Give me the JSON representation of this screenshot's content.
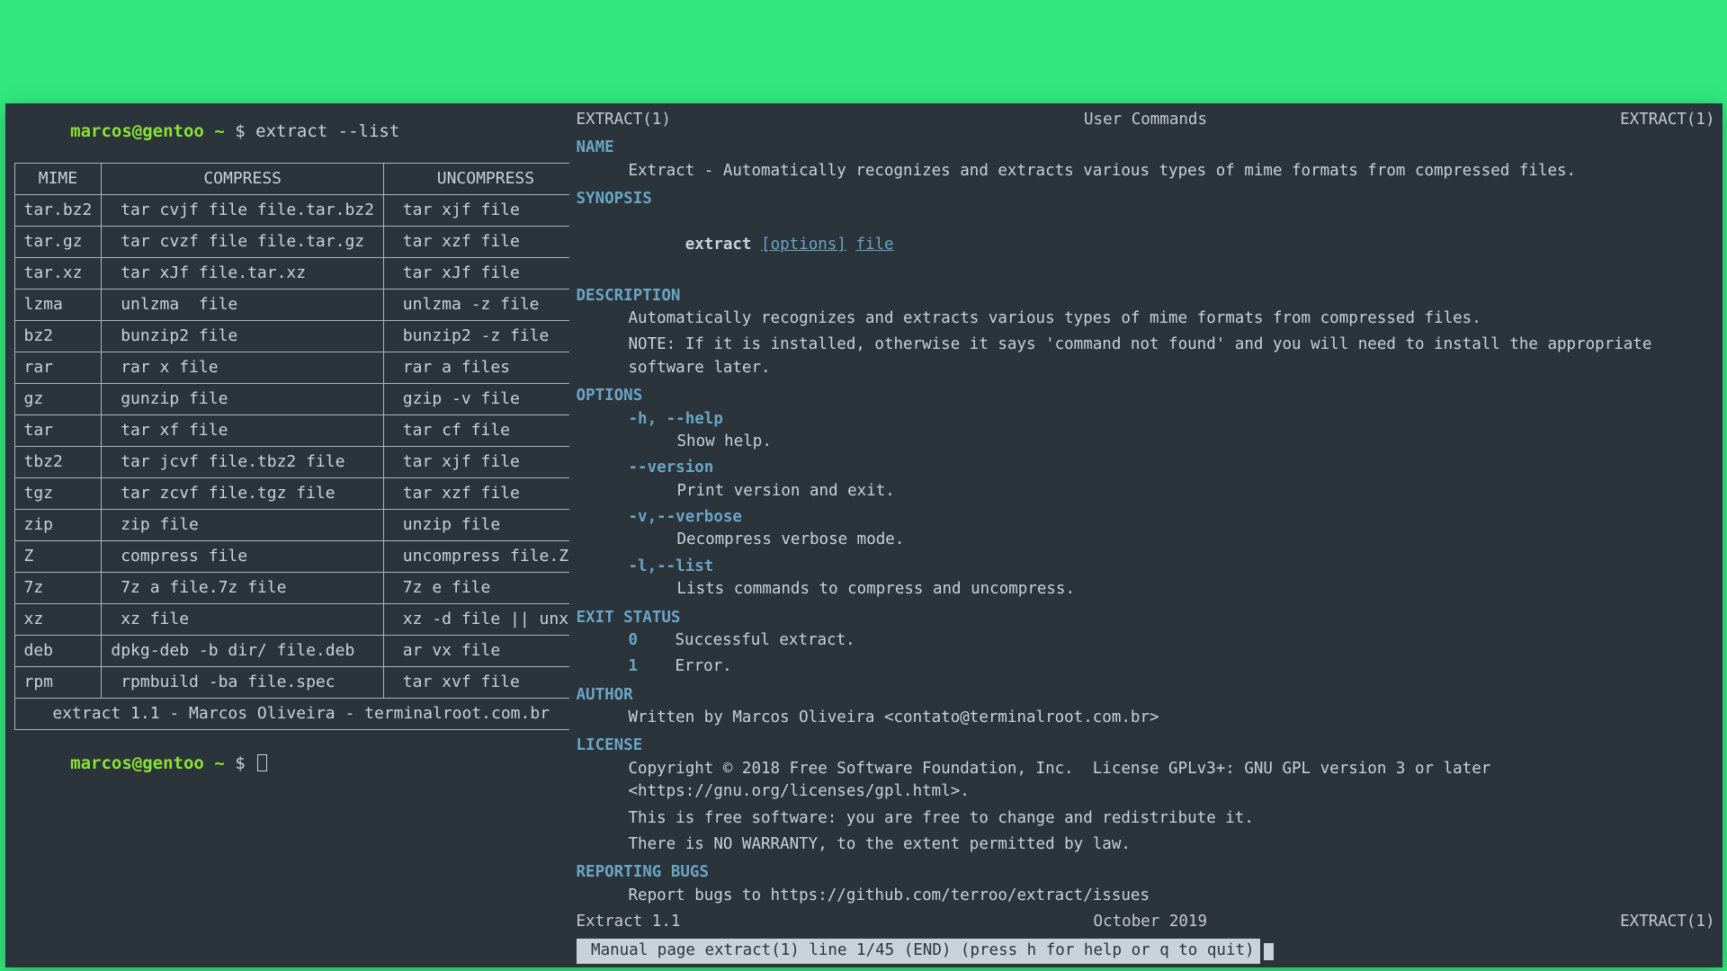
{
  "left_terminal": {
    "prompt_user": "marcos@gentoo",
    "prompt_path": "~",
    "prompt_symbol": "$",
    "command": "extract --list",
    "second_prompt_user": "marcos@gentoo",
    "second_prompt_path": "~",
    "second_prompt_symbol": "$",
    "table": {
      "headers": {
        "mime": "MIME",
        "compress": "COMPRESS",
        "uncompress": "UNCOMPRESS"
      },
      "rows": [
        {
          "mime": "tar.bz2",
          "compress": " tar cvjf file file.tar.bz2",
          "uncompress": " tar xjf file"
        },
        {
          "mime": "tar.gz",
          "compress": " tar cvzf file file.tar.gz",
          "uncompress": " tar xzf file"
        },
        {
          "mime": "tar.xz",
          "compress": " tar xJf file.tar.xz",
          "uncompress": " tar xJf file"
        },
        {
          "mime": "lzma",
          "compress": " unlzma  file",
          "uncompress": " unlzma -z file"
        },
        {
          "mime": "bz2",
          "compress": " bunzip2 file",
          "uncompress": " bunzip2 -z file"
        },
        {
          "mime": "rar",
          "compress": " rar x file",
          "uncompress": " rar a files"
        },
        {
          "mime": "gz",
          "compress": " gunzip file",
          "uncompress": " gzip -v file"
        },
        {
          "mime": "tar",
          "compress": " tar xf file",
          "uncompress": " tar cf file"
        },
        {
          "mime": "tbz2",
          "compress": " tar jcvf file.tbz2 file",
          "uncompress": " tar xjf file"
        },
        {
          "mime": "tgz",
          "compress": " tar zcvf file.tgz file",
          "uncompress": " tar xzf file"
        },
        {
          "mime": "zip",
          "compress": " zip file",
          "uncompress": " unzip file"
        },
        {
          "mime": "Z",
          "compress": " compress file",
          "uncompress": " uncompress file.Z"
        },
        {
          "mime": "7z",
          "compress": " 7z a file.7z file",
          "uncompress": " 7z e file"
        },
        {
          "mime": "xz",
          "compress": " xz file",
          "uncompress": " xz -d file || unxz"
        },
        {
          "mime": "deb",
          "compress": "dpkg-deb -b dir/ file.deb",
          "uncompress": " ar vx file"
        },
        {
          "mime": "rpm",
          "compress": " rpmbuild -ba file.spec",
          "uncompress": " tar xvf file"
        }
      ],
      "footer": "extract 1.1 - Marcos Oliveira - terminalroot.com.br"
    }
  },
  "right_manpage": {
    "header_left": "EXTRACT(1)",
    "header_center": "User Commands",
    "header_right": "EXTRACT(1)",
    "sections": {
      "name_hdr": "NAME",
      "name_body": "Extract - Automatically recognizes and extracts various types of mime formats from compressed files.",
      "synopsis_hdr": "SYNOPSIS",
      "synopsis_cmd": "extract",
      "synopsis_options": "[options]",
      "synopsis_file": "file",
      "description_hdr": "DESCRIPTION",
      "description_1": "Automatically recognizes and extracts various types of mime formats from compressed files.",
      "description_2": "NOTE: If it is installed, otherwise it says 'command not found' and you will need to install the appropriate software later.",
      "options_hdr": "OPTIONS",
      "opt1_flag": "-h, --help",
      "opt1_desc": "Show help.",
      "opt2_flag": "--version",
      "opt2_desc": "Print version and exit.",
      "opt3_flag": "-v,--verbose",
      "opt3_desc": "Decompress verbose mode.",
      "opt4_flag": "-l,--list",
      "opt4_desc": "Lists commands to compress and uncompress.",
      "exit_hdr": "EXIT STATUS",
      "exit0_k": "0",
      "exit0_v": "Successful extract.",
      "exit1_k": "1",
      "exit1_v": "Error.",
      "author_hdr": "AUTHOR",
      "author_body": "Written by Marcos Oliveira <contato@terminalroot.com.br>",
      "license_hdr": "LICENSE",
      "license_1": "Copyright © 2018 Free Software Foundation, Inc.  License GPLv3+: GNU GPL version 3 or later <https://gnu.org/licenses/gpl.html>.",
      "license_2": "This is free software: you are free to change and redistribute it.",
      "license_3": "There is NO WARRANTY, to the extent permitted by law.",
      "bugs_hdr": "REPORTING BUGS",
      "bugs_body": "Report bugs to https://github.com/terroo/extract/issues"
    },
    "footer_left": "Extract 1.1",
    "footer_center": "October 2019",
    "footer_right": "EXTRACT(1)",
    "statusbar": " Manual page extract(1) line 1/45 (END) (press h for help or q to quit)"
  }
}
